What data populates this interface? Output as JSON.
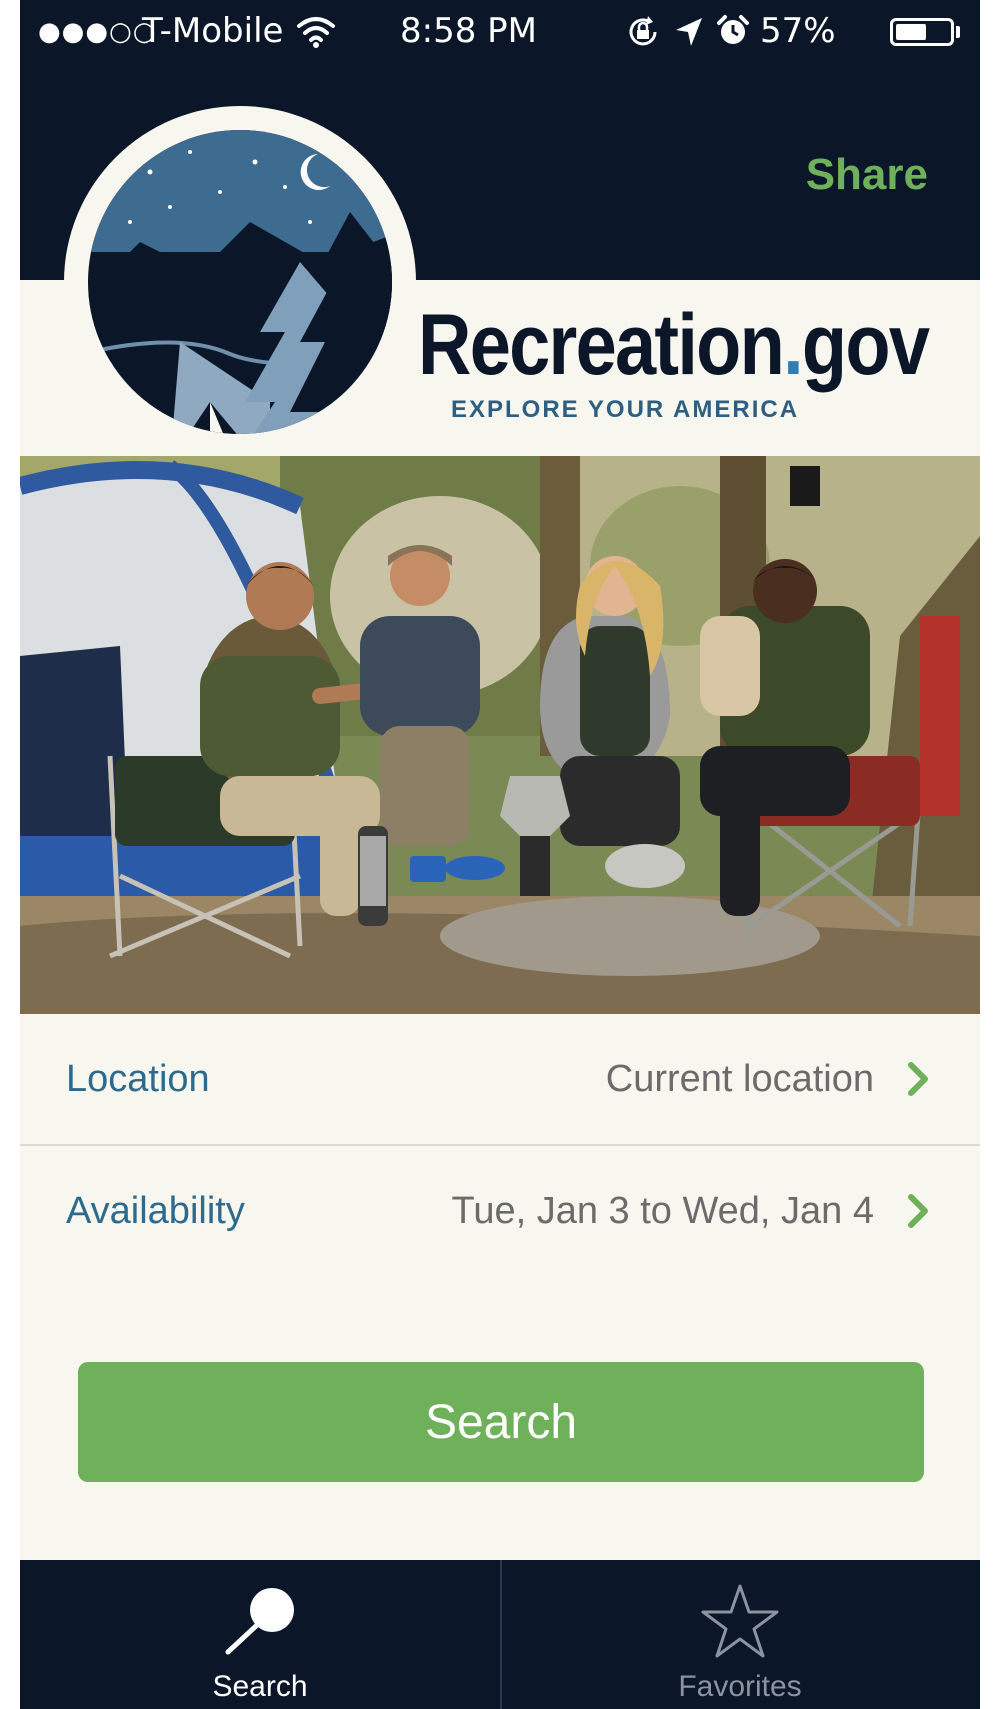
{
  "status_bar": {
    "signal": "●●●○○",
    "carrier": "T-Mobile",
    "time": "8:58 PM",
    "battery_percent": "57%",
    "battery_level": 0.57
  },
  "header": {
    "share_label": "Share"
  },
  "brand": {
    "name_main": "Recreation",
    "name_dot": ".",
    "name_suffix": "gov",
    "tagline": "EXPLORE YOUR AMERICA"
  },
  "form": {
    "location_label": "Location",
    "location_value": "Current location",
    "availability_label": "Availability",
    "availability_value": "Tue, Jan 3 to Wed, Jan 4",
    "search_button_label": "Search"
  },
  "tabs": [
    {
      "label": "Search",
      "icon": "search-icon",
      "active": true
    },
    {
      "label": "Favorites",
      "icon": "star-icon",
      "active": false
    }
  ],
  "colors": {
    "navy": "#0b1628",
    "accent_green": "#6fb05a",
    "label_blue": "#2e6a8d",
    "cream": "#f8f7ef"
  }
}
